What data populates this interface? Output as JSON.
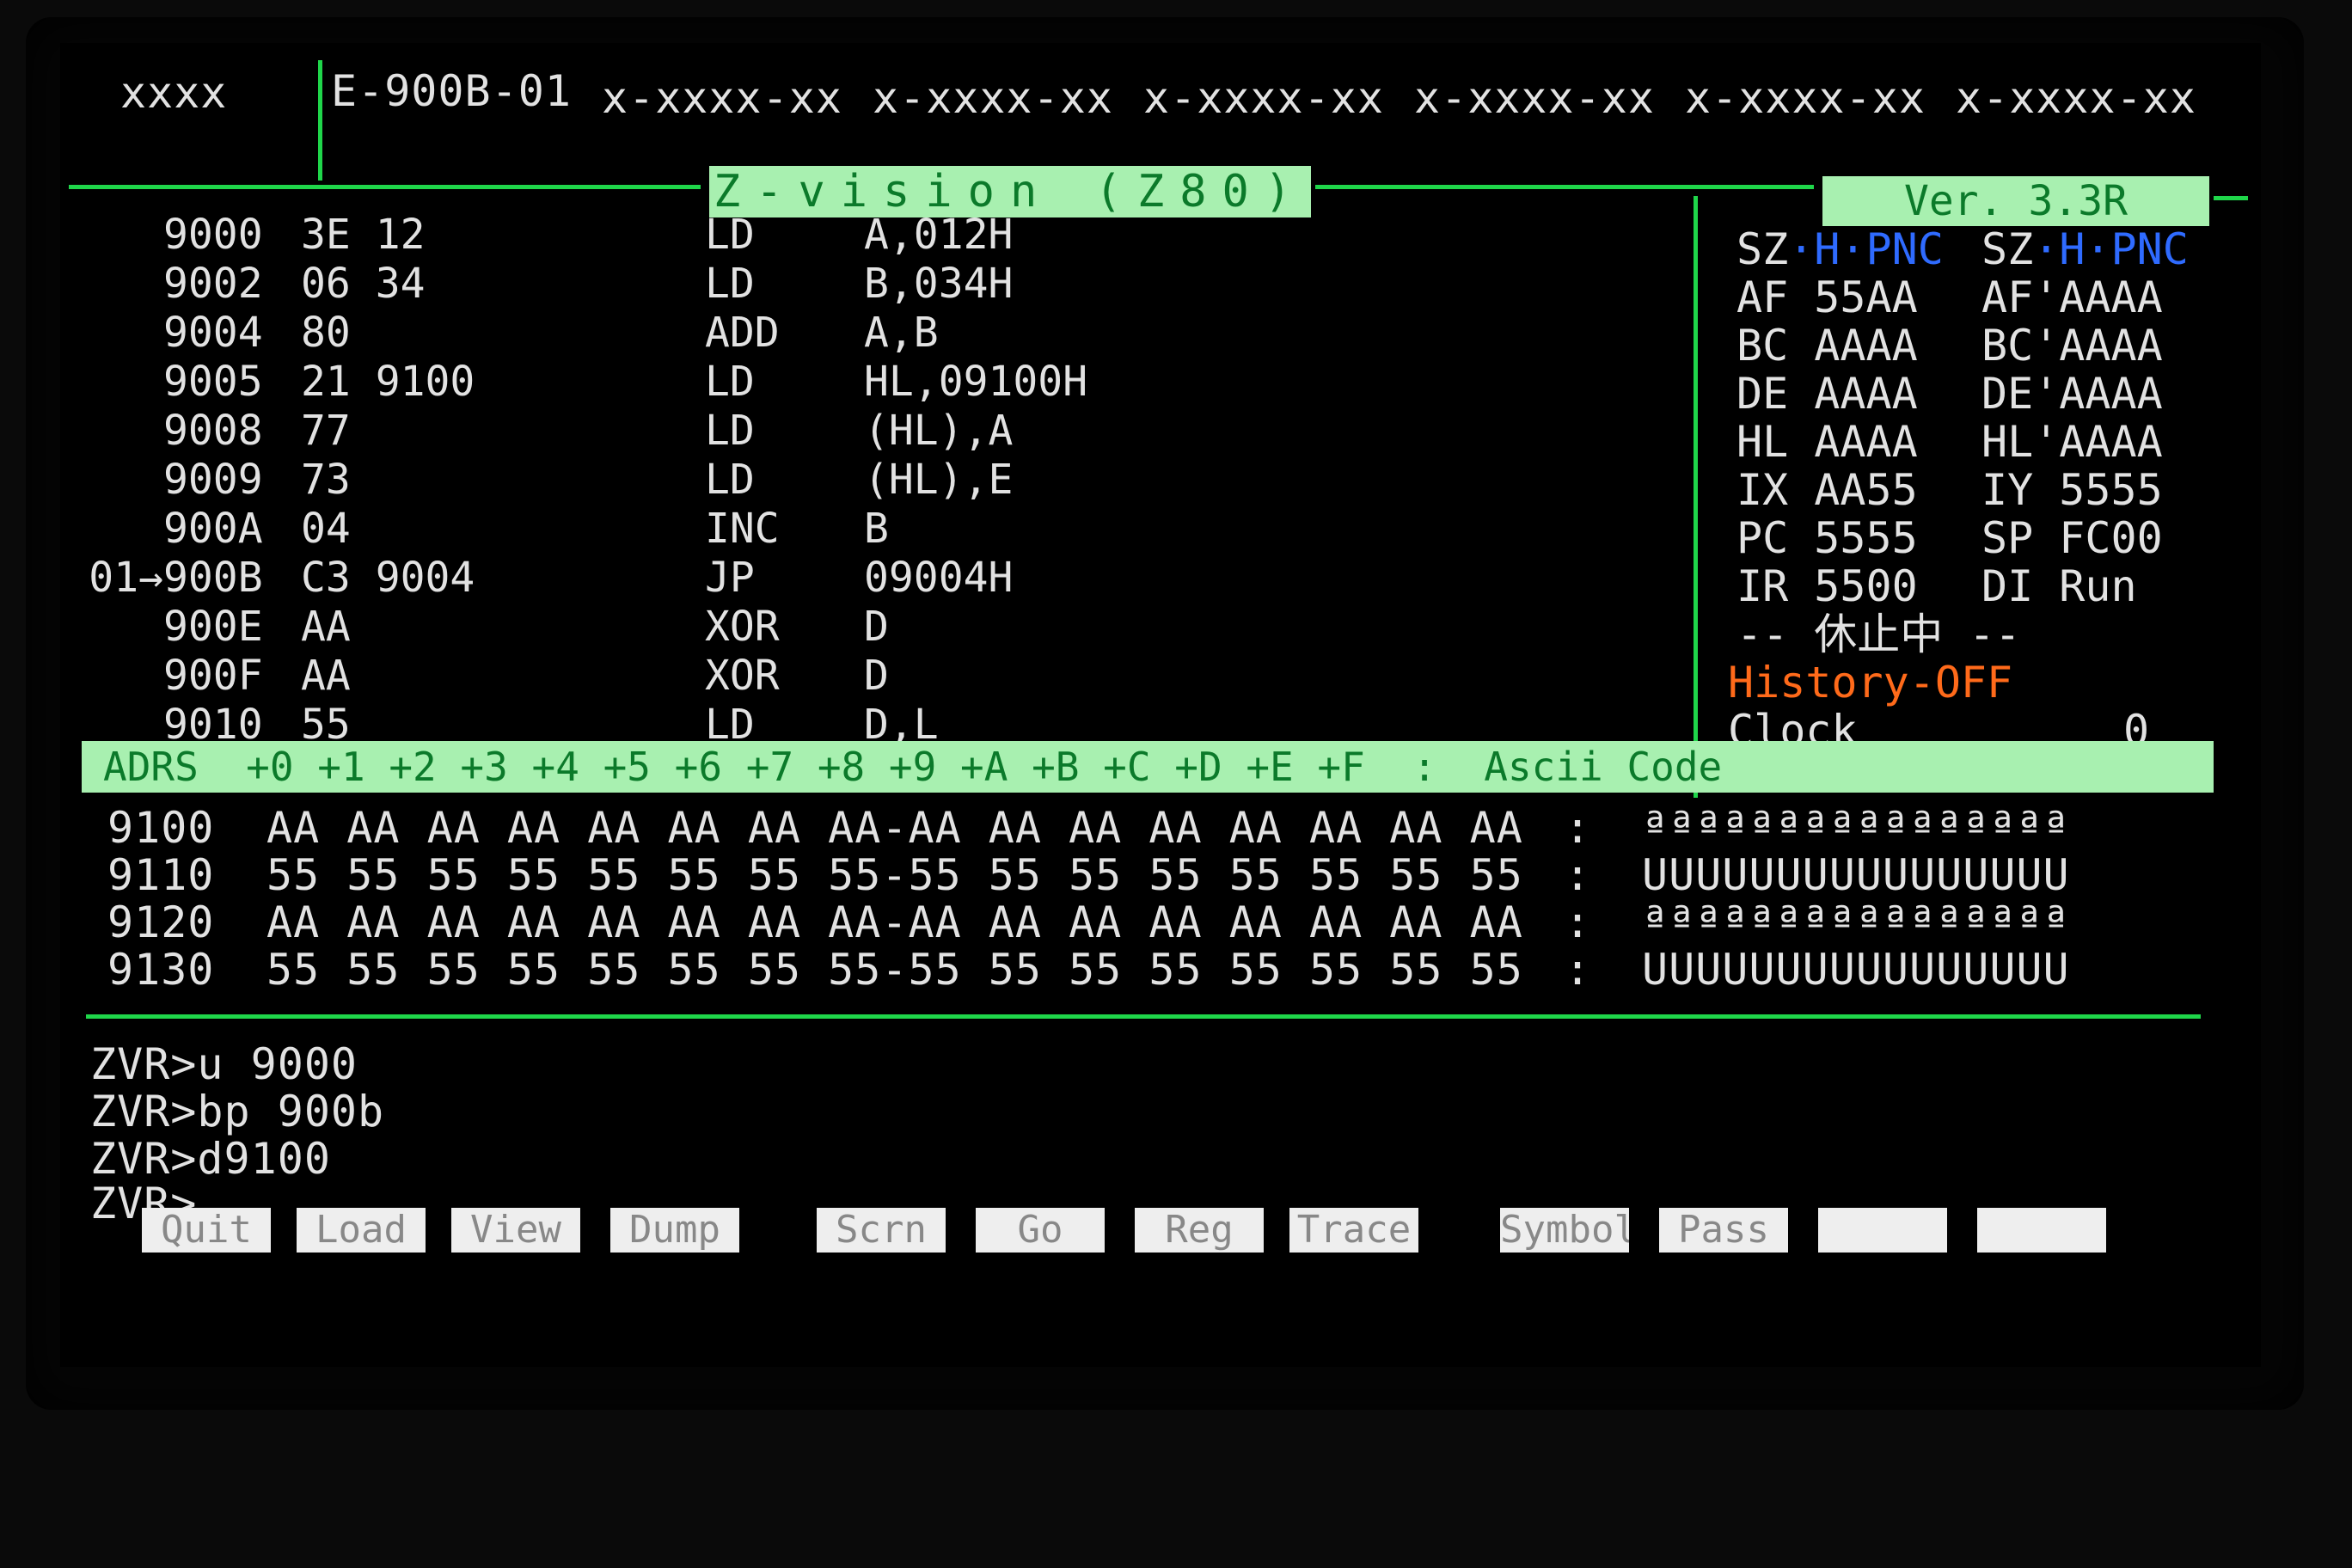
{
  "header": {
    "left": "xxxx",
    "model": "E-900B-01",
    "fields": [
      "x-xxxx-xx",
      "x-xxxx-xx",
      "x-xxxx-xx",
      "x-xxxx-xx",
      "x-xxxx-xx",
      "x-xxxx-xx"
    ]
  },
  "title": "Z-vision (Z80)",
  "version": "Ver. 3.3R",
  "disasm": [
    {
      "bp": "",
      "addr": "9000",
      "bytes": "3E 12",
      "op": "LD",
      "arg": "A,012H"
    },
    {
      "bp": "",
      "addr": "9002",
      "bytes": "06 34",
      "op": "LD",
      "arg": "B,034H"
    },
    {
      "bp": "",
      "addr": "9004",
      "bytes": "80",
      "op": "ADD",
      "arg": "A,B"
    },
    {
      "bp": "",
      "addr": "9005",
      "bytes": "21 9100",
      "op": "LD",
      "arg": "HL,09100H"
    },
    {
      "bp": "",
      "addr": "9008",
      "bytes": "77",
      "op": "LD",
      "arg": "(HL),A"
    },
    {
      "bp": "",
      "addr": "9009",
      "bytes": "73",
      "op": "LD",
      "arg": "(HL),E"
    },
    {
      "bp": "",
      "addr": "900A",
      "bytes": "04",
      "op": "INC",
      "arg": "B"
    },
    {
      "bp": "01→",
      "addr": "900B",
      "bytes": "C3 9004",
      "op": "JP",
      "arg": "09004H"
    },
    {
      "bp": "",
      "addr": "900E",
      "bytes": "AA",
      "op": "XOR",
      "arg": "D"
    },
    {
      "bp": "",
      "addr": "900F",
      "bytes": "AA",
      "op": "XOR",
      "arg": "D"
    },
    {
      "bp": "",
      "addr": "9010",
      "bytes": "55",
      "op": "LD",
      "arg": "D,L"
    }
  ],
  "registers": {
    "flags1a": "SZ",
    "flags1b": "·H·PNC",
    "flags2a": "SZ",
    "flags2b": "·H·PNC",
    "rows": [
      [
        "AF 55AA",
        "AF'AAAA"
      ],
      [
        "BC AAAA",
        "BC'AAAA"
      ],
      [
        "DE AAAA",
        "DE'AAAA"
      ],
      [
        "HL AAAA",
        "HL'AAAA"
      ],
      [
        "IX AA55",
        "IY 5555"
      ],
      [
        "PC 5555",
        "SP FC00"
      ],
      [
        "IR 5500",
        "DI Run"
      ]
    ],
    "status": "-- 休止中 --",
    "history": "History-OFF",
    "clock_label": "Clock",
    "clock_value": "0"
  },
  "dump": {
    "header": "ADRS  +0 +1 +2 +3 +4 +5 +6 +7 +8 +9 +A +B +C +D +E +F  :  Ascii Code",
    "rows": [
      {
        "addr": "9100",
        "hex": "AA AA AA AA AA AA AA AA-AA AA AA AA AA AA AA AA",
        "ascii": "ªªªªªªªªªªªªªªªª"
      },
      {
        "addr": "9110",
        "hex": "55 55 55 55 55 55 55 55-55 55 55 55 55 55 55 55",
        "ascii": "UUUUUUUUUUUUUUUU"
      },
      {
        "addr": "9120",
        "hex": "AA AA AA AA AA AA AA AA-AA AA AA AA AA AA AA AA",
        "ascii": "ªªªªªªªªªªªªªªªª"
      },
      {
        "addr": "9130",
        "hex": "55 55 55 55 55 55 55 55-55 55 55 55 55 55 55 55",
        "ascii": "UUUUUUUUUUUUUUUU"
      }
    ]
  },
  "console": [
    "ZVR>u 9000",
    "ZVR>bp 900b",
    "ZVR>d9100",
    "ZVR>"
  ],
  "fkeys": [
    "Quit",
    "Load",
    "View",
    "Dump",
    "Scrn",
    "Go",
    "Reg",
    "Trace",
    "Symbol",
    "Pass",
    "",
    ""
  ]
}
